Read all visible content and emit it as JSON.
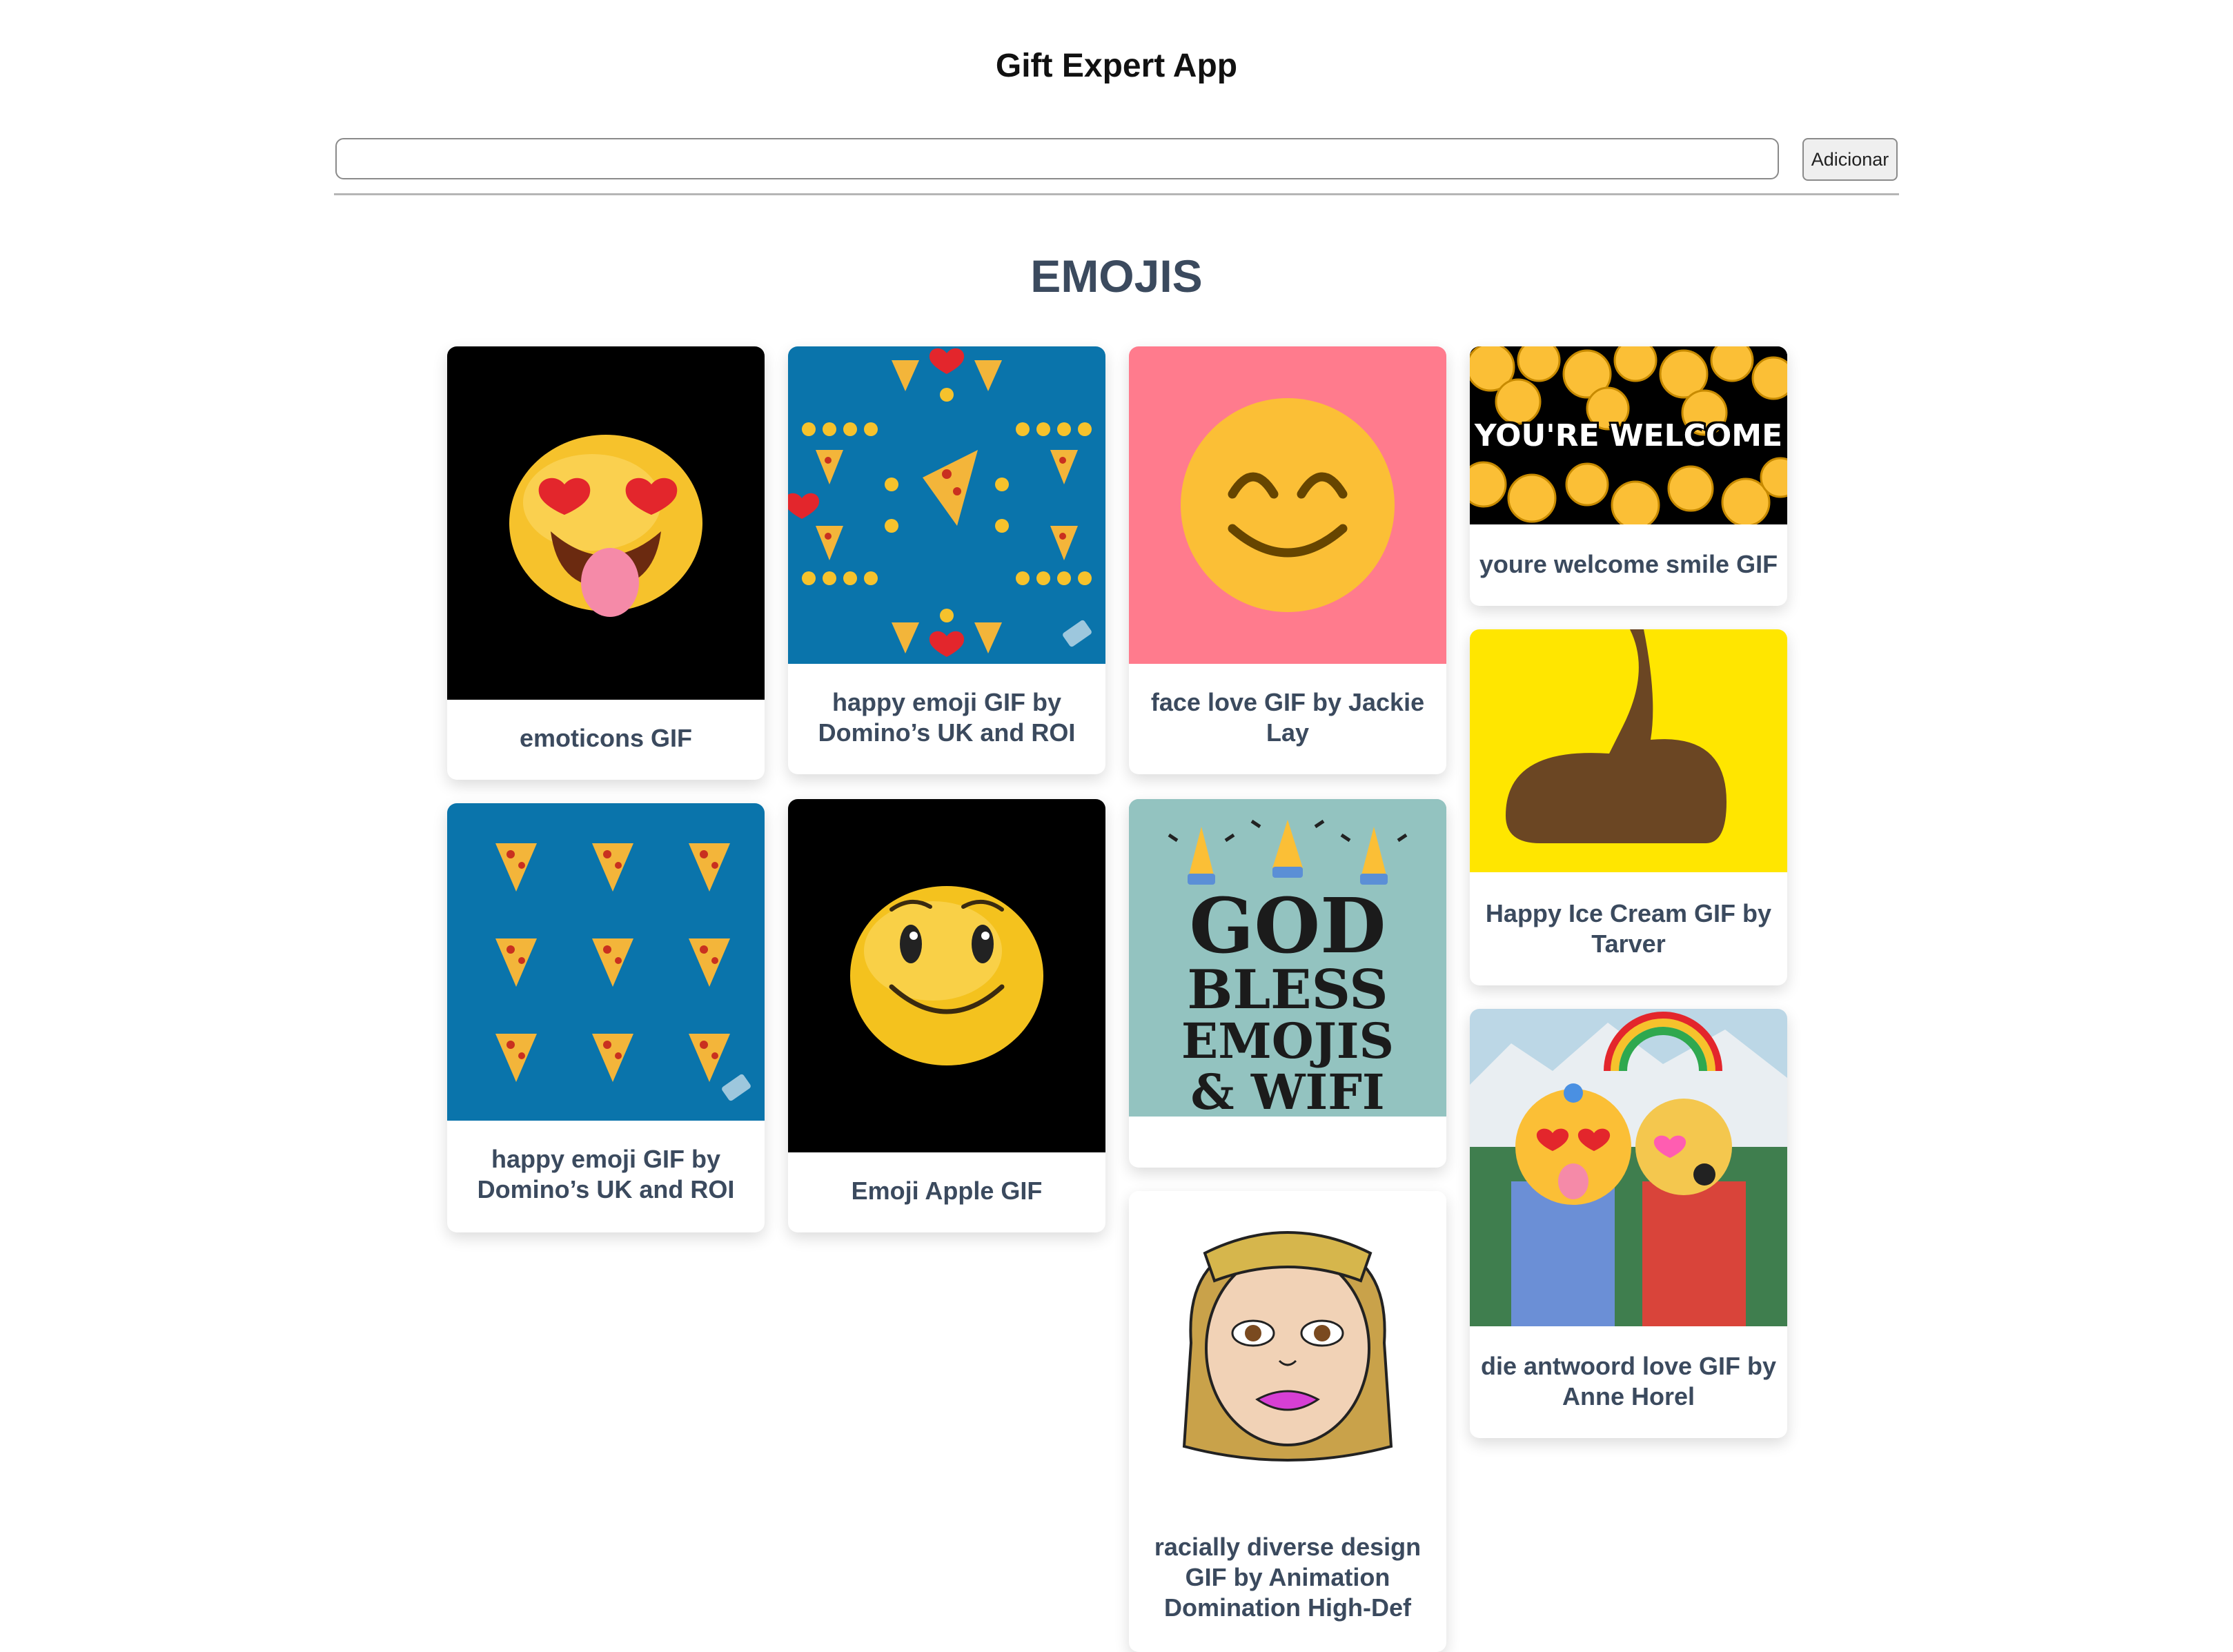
{
  "app": {
    "title": "Gift Expert App"
  },
  "search": {
    "value": "",
    "placeholder": ""
  },
  "add_button": {
    "label": "Adicionar"
  },
  "category": {
    "title": "EMOJIS"
  },
  "gifs": [
    {
      "title": "emoticons GIF",
      "art_text": ""
    },
    {
      "title": "happy emoji GIF by Domino’s UK and ROI",
      "art_text": ""
    },
    {
      "title": "face love GIF by Jackie Lay",
      "art_text": ""
    },
    {
      "title": "youre welcome smile GIF",
      "art_text": "YOU'RE WELCOME"
    },
    {
      "title": "Happy Ice Cream GIF by Tarver",
      "art_text": ""
    },
    {
      "title": "happy emoji GIF by Domino’s UK and ROI",
      "art_text": ""
    },
    {
      "title": "Emoji Apple GIF",
      "art_text": ""
    },
    {
      "title": "",
      "art_lines": [
        "GOD",
        "BLESS",
        "EMOJIS",
        "& WIFI"
      ]
    },
    {
      "title": "die antwoord love GIF by Anne Horel",
      "art_text": ""
    },
    {
      "title": "racially diverse design GIF by Animation Domination High-Def",
      "art_text": ""
    }
  ],
  "colors": {
    "category_text": "#3b4a5e",
    "dominos_blue": "#0a74ab",
    "pink_bg": "#ff7b8d",
    "emoji_yellow": "#fbbf36",
    "snap_yellow": "#ffe600",
    "teal_bg": "#93c3c0"
  }
}
